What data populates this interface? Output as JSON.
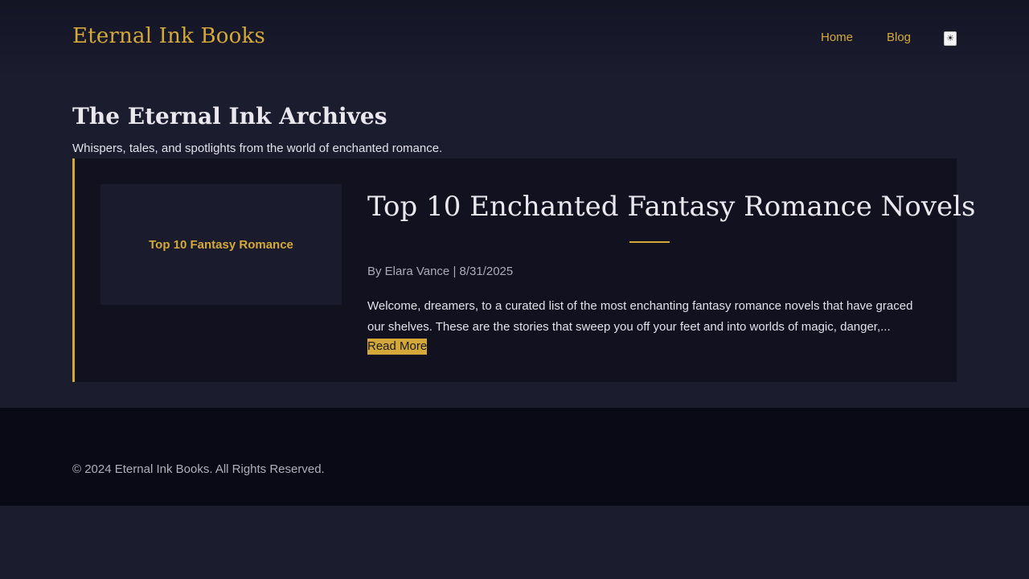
{
  "header": {
    "logo": "Eternal Ink Books",
    "nav": [
      {
        "label": "Home"
      },
      {
        "label": "Blog"
      }
    ],
    "theme_toggle_icon": "☀",
    "theme_toggle_icon_name": "sun-icon"
  },
  "page": {
    "title": "The Eternal Ink Archives",
    "subtitle": "Whispers, tales, and spotlights from the world of enchanted romance."
  },
  "posts": [
    {
      "thumbnail_text": "Top 10 Fantasy Romance",
      "title": "Top 10 Enchanted Fantasy Romance Novels",
      "meta": "By Elara Vance | 8/31/2025",
      "excerpt": "Welcome, dreamers, to a curated list of the most enchanting fantasy romance novels that have graced our shelves. These are the stories that sweep you off your feet and into worlds of magic, danger,...",
      "read_more": "Read More"
    }
  ],
  "footer": {
    "copyright": "© 2024 Eternal Ink Books. All Rights Reserved."
  },
  "colors": {
    "accent": "#d4a93a",
    "background": "#1b1c2e",
    "card": "#11111f",
    "footer": "#0a0a16"
  }
}
